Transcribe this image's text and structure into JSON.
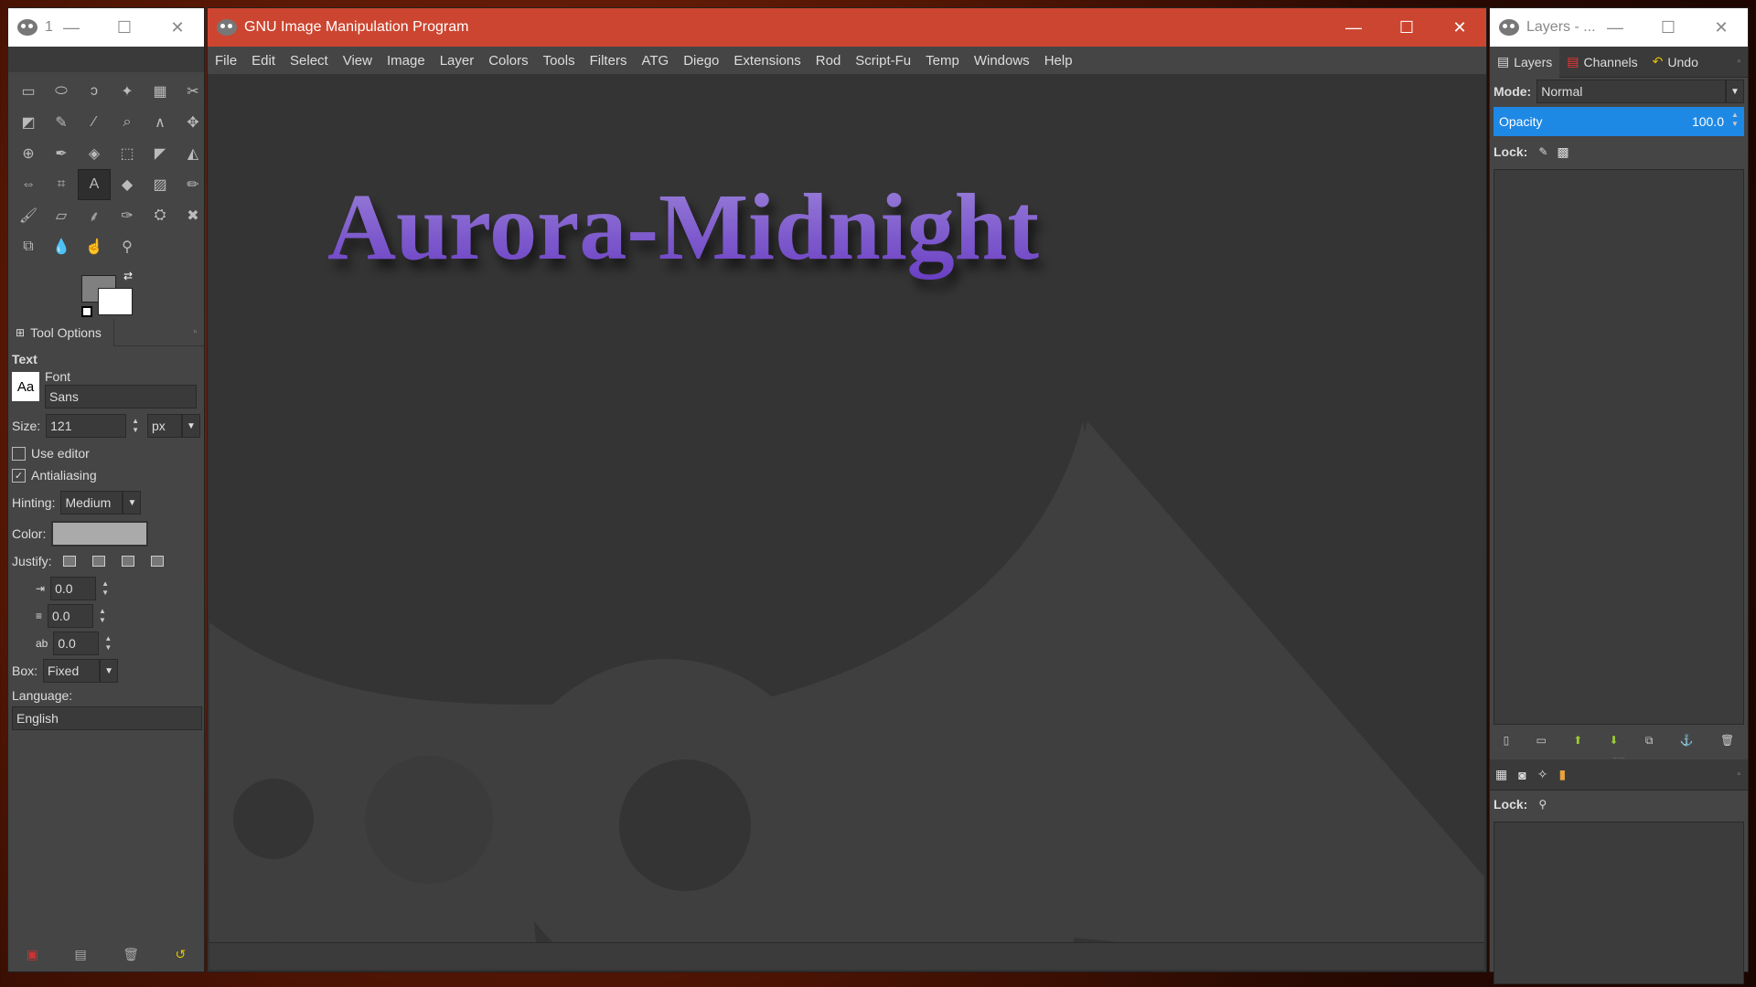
{
  "toolbox": {
    "title": "1",
    "tools": [
      {
        "icon": "rect-select-icon",
        "glyph": "▭"
      },
      {
        "icon": "ellipse-select-icon",
        "glyph": "⬭"
      },
      {
        "icon": "free-select-icon",
        "glyph": "ↄ"
      },
      {
        "icon": "fuzzy-select-icon",
        "glyph": "✦"
      },
      {
        "icon": "color-select-icon",
        "glyph": "▦"
      },
      {
        "icon": "scissors-select-icon",
        "glyph": "✂"
      },
      {
        "icon": "foreground-select-icon",
        "glyph": "◩"
      },
      {
        "icon": "paths-icon",
        "glyph": "✎"
      },
      {
        "icon": "color-picker-icon",
        "glyph": "⁄"
      },
      {
        "icon": "zoom-icon",
        "glyph": "⌕"
      },
      {
        "icon": "measure-icon",
        "glyph": "∧"
      },
      {
        "icon": "move-icon",
        "glyph": "✥"
      },
      {
        "icon": "align-icon",
        "glyph": "⊕"
      },
      {
        "icon": "crop-icon",
        "glyph": "✒"
      },
      {
        "icon": "rotate-icon",
        "glyph": "◈"
      },
      {
        "icon": "scale-icon",
        "glyph": "⬚"
      },
      {
        "icon": "shear-icon",
        "glyph": "◤"
      },
      {
        "icon": "perspective-icon",
        "glyph": "◭"
      },
      {
        "icon": "flip-icon",
        "glyph": "⇔"
      },
      {
        "icon": "cage-icon",
        "glyph": "⌗"
      },
      {
        "icon": "text-tool-icon",
        "glyph": "A"
      },
      {
        "icon": "bucket-fill-icon",
        "glyph": "◆"
      },
      {
        "icon": "gradient-icon",
        "glyph": "▨"
      },
      {
        "icon": "pencil-icon",
        "glyph": "✏"
      },
      {
        "icon": "paintbrush-icon",
        "glyph": "🖌"
      },
      {
        "icon": "eraser-icon",
        "glyph": "▱"
      },
      {
        "icon": "airbrush-icon",
        "glyph": "⸙"
      },
      {
        "icon": "ink-icon",
        "glyph": "✑"
      },
      {
        "icon": "clone-icon",
        "glyph": "⛭"
      },
      {
        "icon": "heal-icon",
        "glyph": "✖"
      },
      {
        "icon": "perspective-clone-icon",
        "glyph": "⧉"
      },
      {
        "icon": "blur-icon",
        "glyph": "💧"
      },
      {
        "icon": "smudge-icon",
        "glyph": "☝"
      },
      {
        "icon": "dodge-burn-icon",
        "glyph": "⚲"
      }
    ],
    "tool_options_tab": "Tool Options",
    "tool_name": "Text",
    "font_label": "Font",
    "font_value": "Sans",
    "font_preview": "Aa",
    "size_label": "Size:",
    "size_value": "121",
    "size_unit": "px",
    "use_editor_label": "Use editor",
    "use_editor_checked": false,
    "antialiasing_label": "Antialiasing",
    "antialiasing_checked": true,
    "hinting_label": "Hinting:",
    "hinting_value": "Medium",
    "color_label": "Color:",
    "color_value": "#aaaaaa",
    "justify_label": "Justify:",
    "indent_value": "0.0",
    "line_spacing_value": "0.0",
    "letter_spacing_value": "0.0",
    "box_label": "Box:",
    "box_value": "Fixed",
    "language_label": "Language:",
    "language_value": "English"
  },
  "main": {
    "title": "GNU Image Manipulation Program",
    "menus": [
      "File",
      "Edit",
      "Select",
      "View",
      "Image",
      "Layer",
      "Colors",
      "Tools",
      "Filters",
      "ATG",
      "Diego",
      "Extensions",
      "Rod",
      "Script-Fu",
      "Temp",
      "Windows",
      "Help"
    ],
    "canvas_text": "Aurora-Midnight",
    "canvas_text_color_top": "#9b82d9",
    "canvas_text_color_bottom": "#6a3fc4"
  },
  "layers": {
    "title": "Layers - ...",
    "tabs": [
      "Layers",
      "Channels",
      "Undo"
    ],
    "mode_label": "Mode:",
    "mode_value": "Normal",
    "opacity_label": "Opacity",
    "opacity_value": "100.0",
    "lock_label": "Lock:",
    "lock2_label": "Lock:"
  }
}
